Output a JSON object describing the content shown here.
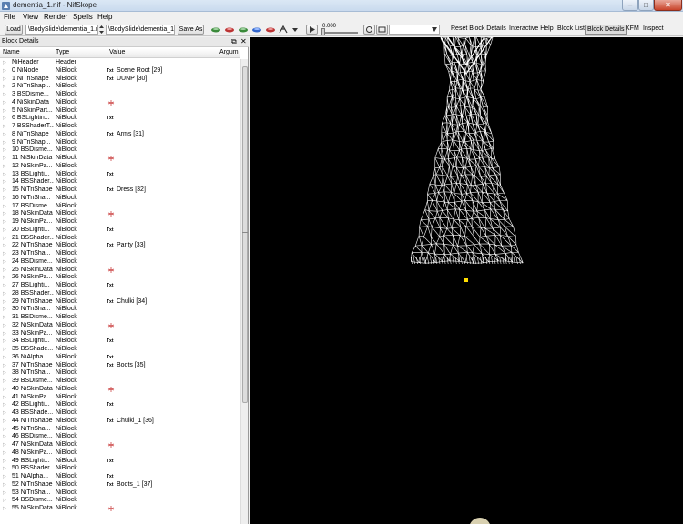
{
  "window": {
    "title": "dementia_1.nif - NifSkope",
    "min_icon": "minimize-icon",
    "max_icon": "maximize-icon",
    "close_icon": "close-icon",
    "min_glyph": "–",
    "max_glyph": "□",
    "close_glyph": "✕"
  },
  "menu": [
    "File",
    "View",
    "Render",
    "Spells",
    "Help"
  ],
  "toolbar": {
    "load_label": "Load",
    "load_path": "\\BodySlide\\dementia_1.nif",
    "save_path": "\\BodySlide\\dementia_1.nif",
    "save_as_label": "Save As",
    "slider_value": "0.000",
    "reset_label": "Reset Block Details",
    "help_label": "Interactive Help",
    "block_list_label": "Block List",
    "block_details_label": "Block Details",
    "kfm_label": "KFM",
    "inspect_label": "Inspect"
  },
  "panel": {
    "title": "Block Details",
    "float_glyph": "⧉",
    "close_glyph": "✕",
    "columns": {
      "name": "Name",
      "type": "Type",
      "value": "Value",
      "argument": "Argum"
    },
    "rows": [
      {
        "name": "NiHeader",
        "type": "Header",
        "icon": "",
        "value": ""
      },
      {
        "name": "0 NiNode",
        "type": "NiBlock",
        "icon": "txt",
        "value": "Scene Root [29]"
      },
      {
        "name": "1 NiTriShape",
        "type": "NiBlock",
        "icon": "txt",
        "value": "UUNP [30]"
      },
      {
        "name": "2 NiTriShap...",
        "type": "NiBlock",
        "icon": "",
        "value": ""
      },
      {
        "name": "3 BSDisme...",
        "type": "NiBlock",
        "icon": "",
        "value": ""
      },
      {
        "name": "4 NiSkinData",
        "type": "NiBlock",
        "icon": "tri",
        "value": ""
      },
      {
        "name": "5 NiSkinPart...",
        "type": "NiBlock",
        "icon": "",
        "value": ""
      },
      {
        "name": "6 BSLightin...",
        "type": "NiBlock",
        "icon": "txt",
        "value": ""
      },
      {
        "name": "7 BSShaderT...",
        "type": "NiBlock",
        "icon": "",
        "value": ""
      },
      {
        "name": "8 NiTriShape",
        "type": "NiBlock",
        "icon": "txt",
        "value": "Arms [31]"
      },
      {
        "name": "9 NiTriShap...",
        "type": "NiBlock",
        "icon": "",
        "value": ""
      },
      {
        "name": "10 BSDisme...",
        "type": "NiBlock",
        "icon": "",
        "value": ""
      },
      {
        "name": "11 NiSkinData",
        "type": "NiBlock",
        "icon": "tri",
        "value": ""
      },
      {
        "name": "12 NiSkinPa...",
        "type": "NiBlock",
        "icon": "",
        "value": ""
      },
      {
        "name": "13 BSLighti...",
        "type": "NiBlock",
        "icon": "txt",
        "value": ""
      },
      {
        "name": "14 BSShader...",
        "type": "NiBlock",
        "icon": "",
        "value": ""
      },
      {
        "name": "15 NiTriShape",
        "type": "NiBlock",
        "icon": "txt",
        "value": "Dress [32]"
      },
      {
        "name": "16 NiTriSha...",
        "type": "NiBlock",
        "icon": "",
        "value": ""
      },
      {
        "name": "17 BSDisme...",
        "type": "NiBlock",
        "icon": "",
        "value": ""
      },
      {
        "name": "18 NiSkinData",
        "type": "NiBlock",
        "icon": "tri",
        "value": ""
      },
      {
        "name": "19 NiSkinPa...",
        "type": "NiBlock",
        "icon": "",
        "value": ""
      },
      {
        "name": "20 BSLighti...",
        "type": "NiBlock",
        "icon": "txt",
        "value": ""
      },
      {
        "name": "21 BSShader...",
        "type": "NiBlock",
        "icon": "",
        "value": ""
      },
      {
        "name": "22 NiTriShape",
        "type": "NiBlock",
        "icon": "txt",
        "value": "Panty [33]"
      },
      {
        "name": "23 NiTriSha...",
        "type": "NiBlock",
        "icon": "",
        "value": ""
      },
      {
        "name": "24 BSDisme...",
        "type": "NiBlock",
        "icon": "",
        "value": ""
      },
      {
        "name": "25 NiSkinData",
        "type": "NiBlock",
        "icon": "tri",
        "value": ""
      },
      {
        "name": "26 NiSkinPa...",
        "type": "NiBlock",
        "icon": "",
        "value": ""
      },
      {
        "name": "27 BSLighti...",
        "type": "NiBlock",
        "icon": "txt",
        "value": ""
      },
      {
        "name": "28 BSShader...",
        "type": "NiBlock",
        "icon": "",
        "value": ""
      },
      {
        "name": "29 NiTriShape",
        "type": "NiBlock",
        "icon": "txt",
        "value": "Chulki [34]"
      },
      {
        "name": "30 NiTriSha...",
        "type": "NiBlock",
        "icon": "",
        "value": ""
      },
      {
        "name": "31 BSDisme...",
        "type": "NiBlock",
        "icon": "",
        "value": ""
      },
      {
        "name": "32 NiSkinData",
        "type": "NiBlock",
        "icon": "tri",
        "value": ""
      },
      {
        "name": "33 NiSkinPa...",
        "type": "NiBlock",
        "icon": "",
        "value": ""
      },
      {
        "name": "34 BSLighti...",
        "type": "NiBlock",
        "icon": "txt",
        "value": ""
      },
      {
        "name": "35 BSShade...",
        "type": "NiBlock",
        "icon": "",
        "value": ""
      },
      {
        "name": "36 NiAlpha...",
        "type": "NiBlock",
        "icon": "txt",
        "value": ""
      },
      {
        "name": "37 NiTriShape",
        "type": "NiBlock",
        "icon": "txt",
        "value": "Boots [35]"
      },
      {
        "name": "38 NiTriSha...",
        "type": "NiBlock",
        "icon": "",
        "value": ""
      },
      {
        "name": "39 BSDisme...",
        "type": "NiBlock",
        "icon": "",
        "value": ""
      },
      {
        "name": "40 NiSkinData",
        "type": "NiBlock",
        "icon": "tri",
        "value": ""
      },
      {
        "name": "41 NiSkinPa...",
        "type": "NiBlock",
        "icon": "",
        "value": ""
      },
      {
        "name": "42 BSLighti...",
        "type": "NiBlock",
        "icon": "txt",
        "value": ""
      },
      {
        "name": "43 BSShade...",
        "type": "NiBlock",
        "icon": "",
        "value": ""
      },
      {
        "name": "44 NiTriShape",
        "type": "NiBlock",
        "icon": "txt",
        "value": "Chulki_1 [36]"
      },
      {
        "name": "45 NiTriSha...",
        "type": "NiBlock",
        "icon": "",
        "value": ""
      },
      {
        "name": "46 BSDisme...",
        "type": "NiBlock",
        "icon": "",
        "value": ""
      },
      {
        "name": "47 NiSkinData",
        "type": "NiBlock",
        "icon": "tri",
        "value": ""
      },
      {
        "name": "48 NiSkinPa...",
        "type": "NiBlock",
        "icon": "",
        "value": ""
      },
      {
        "name": "49 BSLighti...",
        "type": "NiBlock",
        "icon": "txt",
        "value": ""
      },
      {
        "name": "50 BSShader...",
        "type": "NiBlock",
        "icon": "",
        "value": ""
      },
      {
        "name": "51 NiAlpha...",
        "type": "NiBlock",
        "icon": "txt",
        "value": ""
      },
      {
        "name": "52 NiTriShape",
        "type": "NiBlock",
        "icon": "txt",
        "value": "Boots_1 [37]"
      },
      {
        "name": "53 NiTriSha...",
        "type": "NiBlock",
        "icon": "",
        "value": ""
      },
      {
        "name": "54 BSDisme...",
        "type": "NiBlock",
        "icon": "",
        "value": ""
      },
      {
        "name": "55 NiSkinData",
        "type": "NiBlock",
        "icon": "tri",
        "value": ""
      }
    ]
  },
  "viewport": {
    "background": "#000000",
    "mesh_color": "#ffffff",
    "marker_color": "#ffdd00",
    "mesh_name": "wireframe-dress-mesh"
  }
}
